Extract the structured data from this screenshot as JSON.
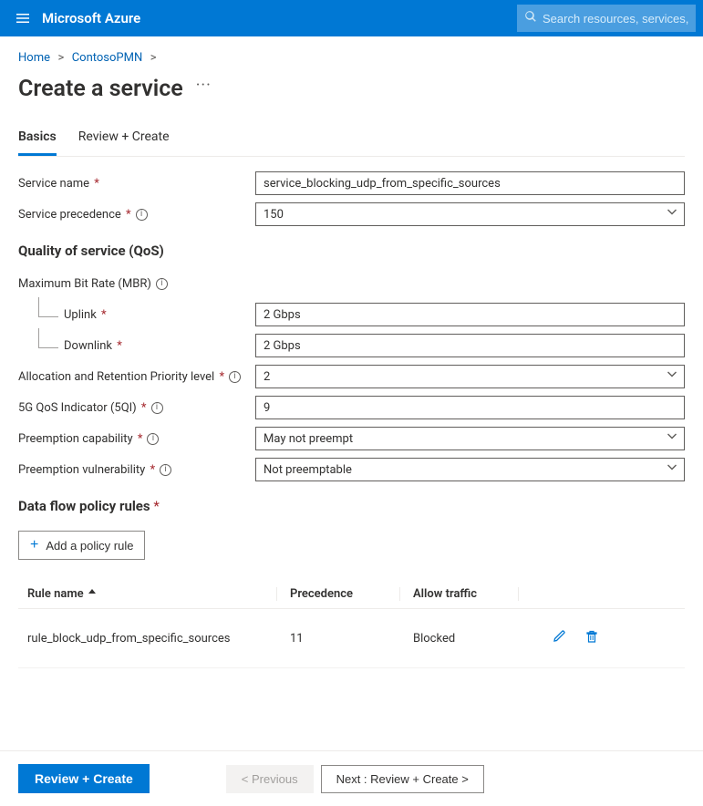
{
  "brand": "Microsoft Azure",
  "search": {
    "placeholder": "Search resources, services, and"
  },
  "breadcrumb": {
    "home": "Home",
    "parent": "ContosoPMN"
  },
  "page_title": "Create a service",
  "tabs": {
    "basics": "Basics",
    "review": "Review + Create"
  },
  "labels": {
    "service_name": "Service name",
    "service_precedence": "Service precedence",
    "qos_heading": "Quality of service (QoS)",
    "mbr": "Maximum Bit Rate (MBR)",
    "uplink": "Uplink",
    "downlink": "Downlink",
    "arp": "Allocation and Retention Priority level",
    "fiveqi": "5G QoS Indicator (5QI)",
    "preempt_cap": "Preemption capability",
    "preempt_vuln": "Preemption vulnerability",
    "rules_heading": "Data flow policy rules",
    "add_rule": "Add a policy rule"
  },
  "values": {
    "service_name": "service_blocking_udp_from_specific_sources",
    "service_precedence": "150",
    "uplink": "2 Gbps",
    "downlink": "2 Gbps",
    "arp": "2",
    "fiveqi": "9",
    "preempt_cap": "May not preempt",
    "preempt_vuln": "Not preemptable"
  },
  "table": {
    "headers": {
      "rule_name": "Rule name",
      "precedence": "Precedence",
      "allow_traffic": "Allow traffic"
    },
    "rows": [
      {
        "name": "rule_block_udp_from_specific_sources",
        "precedence": "11",
        "allow": "Blocked"
      }
    ]
  },
  "footer": {
    "review_create": "Review + Create",
    "previous": "< Previous",
    "next": "Next : Review + Create >"
  }
}
